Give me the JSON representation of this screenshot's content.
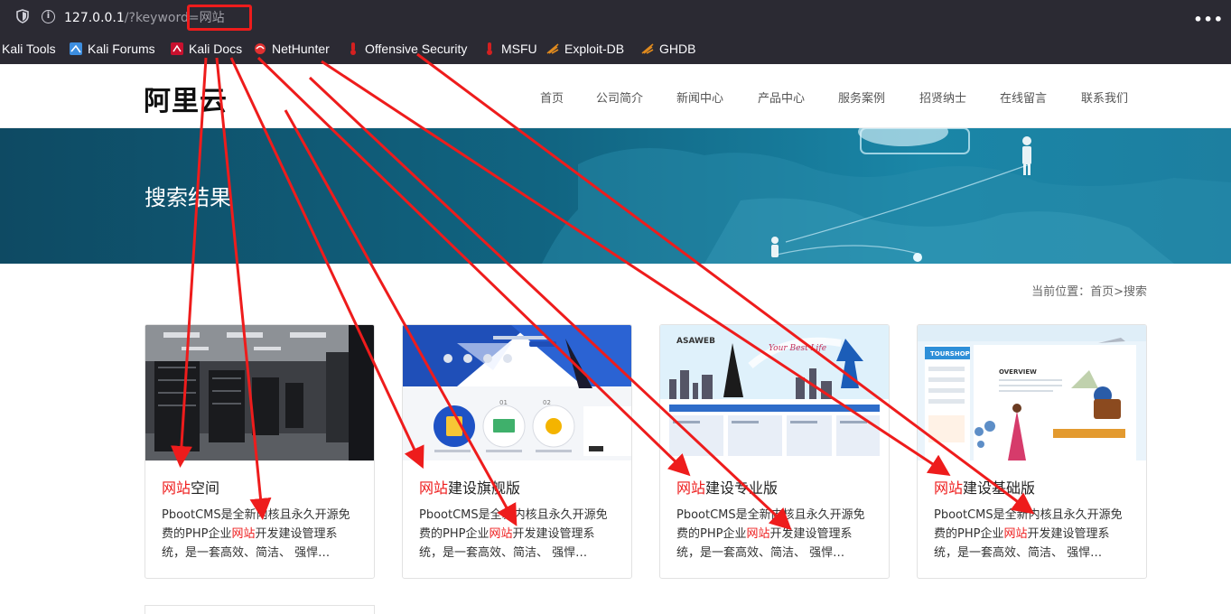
{
  "browser": {
    "url_host": "127.0.0.1",
    "url_path": "/?keyword=",
    "url_keyword": "网站",
    "menu_icon": "kebab-menu-icon"
  },
  "bookmarks": [
    {
      "label": "Kali Tools",
      "icon": "kali-icon"
    },
    {
      "label": "Kali Forums",
      "icon": "kali-forums-icon"
    },
    {
      "label": "Kali Docs",
      "icon": "kali-docs-icon"
    },
    {
      "label": "NetHunter",
      "icon": "nethunter-icon"
    },
    {
      "label": "Offensive Security",
      "icon": "offsec-icon"
    },
    {
      "label": "MSFU",
      "icon": "offsec-icon"
    },
    {
      "label": "Exploit-DB",
      "icon": "exploitdb-icon"
    },
    {
      "label": "GHDB",
      "icon": "exploitdb-icon"
    }
  ],
  "site": {
    "logo": "阿里云",
    "nav": [
      "首页",
      "公司简介",
      "新闻中心",
      "产品中心",
      "服务案例",
      "招贤纳士",
      "在线留言",
      "联系我们"
    ],
    "banner_title": "搜索结果",
    "breadcrumb": "当前位置：首页>搜索"
  },
  "results": [
    {
      "title_hl": "网站",
      "title_rest": "空间",
      "desc_a": "PbootCMS是全新内核且永久开源免费的PHP企业",
      "desc_hl": "网站",
      "desc_b": "开发建设管理系统，是一套高效、简洁、 强悍…"
    },
    {
      "title_hl": "网站",
      "title_rest": "建设旗舰版",
      "desc_a": "PbootCMS是全新内核且永久开源免费的PHP企业",
      "desc_hl": "网站",
      "desc_b": "开发建设管理系统，是一套高效、简洁、 强悍…"
    },
    {
      "title_hl": "网站",
      "title_rest": "建设专业版",
      "desc_a": "PbootCMS是全新内核且永久开源免费的PHP企业",
      "desc_hl": "网站",
      "desc_b": "开发建设管理系统，是一套高效、简洁、 强悍…"
    },
    {
      "title_hl": "网站",
      "title_rest": "建设基础版",
      "desc_a": "PbootCMS是全新内核且永久开源免费的PHP企业",
      "desc_hl": "网站",
      "desc_b": "开发建设管理系统，是一套高效、简洁、 强悍…"
    }
  ],
  "thumbs": {
    "tile2": {
      "labels": [
        "01",
        "02"
      ]
    },
    "tile3": {
      "brand": "ASAWEB",
      "headline": "Your Best Life"
    },
    "tile4": {
      "brand": "TOURSHOP",
      "heading": "OVERVIEW"
    }
  },
  "annotation_color": "#ee1c1c"
}
